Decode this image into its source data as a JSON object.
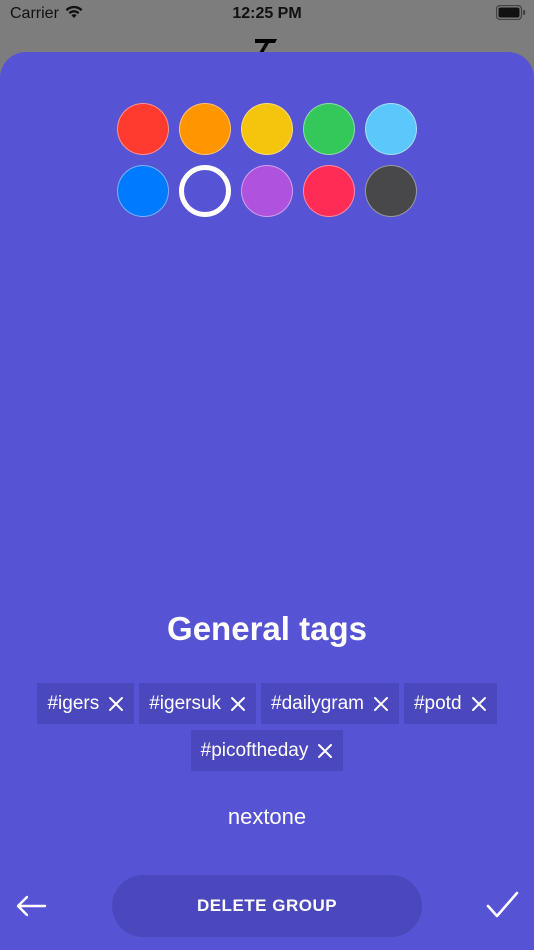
{
  "status_bar": {
    "carrier": "Carrier",
    "time": "12:25 PM"
  },
  "swatches": [
    {
      "color": "#ff3b30",
      "selected": false
    },
    {
      "color": "#ff9500",
      "selected": false
    },
    {
      "color": "#f5c40c",
      "selected": false
    },
    {
      "color": "#34c759",
      "selected": false
    },
    {
      "color": "#5ac8fa",
      "selected": false
    },
    {
      "color": "#007aff",
      "selected": false
    },
    {
      "color": "#5753d5",
      "selected": true
    },
    {
      "color": "#af52de",
      "selected": false
    },
    {
      "color": "#ff2d55",
      "selected": false
    },
    {
      "color": "#48484a",
      "selected": false
    }
  ],
  "group": {
    "title": "General tags",
    "tags": [
      "#igers",
      "#igersuk",
      "#dailygram",
      "#potd",
      "#picoftheday"
    ],
    "input_value": "nextone"
  },
  "actions": {
    "delete_label": "DELETE GROUP"
  },
  "theme": {
    "sheet_bg": "#5753d5",
    "chip_bg": "#4b48bd"
  }
}
